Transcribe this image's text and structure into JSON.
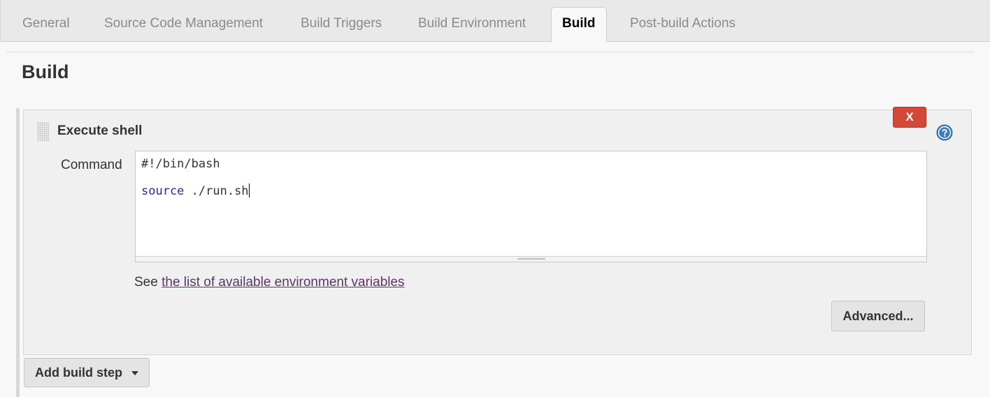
{
  "tabs": [
    {
      "label": "General"
    },
    {
      "label": "Source Code Management"
    },
    {
      "label": "Build Triggers"
    },
    {
      "label": "Build Environment"
    },
    {
      "label": "Build"
    },
    {
      "label": "Post-build Actions"
    }
  ],
  "active_tab": "Build",
  "section": {
    "title": "Build"
  },
  "step": {
    "title": "Execute shell",
    "delete_label": "X",
    "help_icon": "question-circle-icon",
    "command_label": "Command",
    "command_lines": {
      "line1": "#!/bin/bash",
      "line2_keyword": "source",
      "line2_rest": " ./run.sh"
    },
    "see_prefix": "See ",
    "see_link": "the list of available environment variables",
    "advanced_label": "Advanced..."
  },
  "add_step": {
    "label": "Add build step",
    "icon": "caret-down-icon"
  },
  "colors": {
    "delete_red": "#d24939",
    "link_purple": "#5c3566",
    "keyword_blue": "#3b1ea8",
    "help_blue": "#3a7bbf"
  }
}
